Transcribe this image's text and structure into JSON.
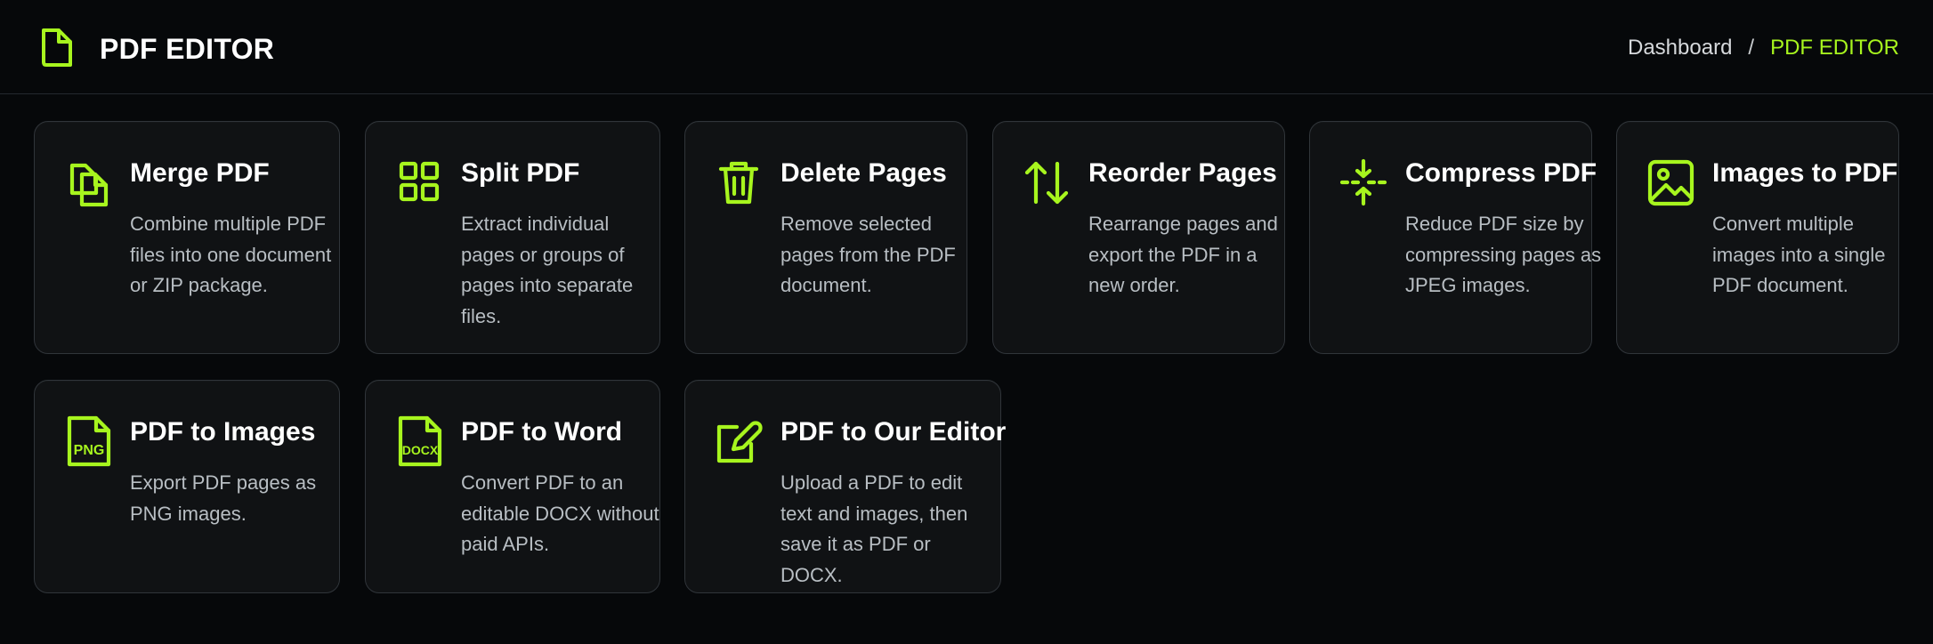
{
  "header": {
    "title": "PDF EDITOR",
    "brand_icon": "document-icon",
    "breadcrumb": {
      "home": "Dashboard",
      "separator": "/",
      "current": "PDF EDITOR"
    }
  },
  "tools": [
    {
      "title": "Merge PDF",
      "description": "Combine multiple PDF files into one document or ZIP package.",
      "icon": "merge-icon"
    },
    {
      "title": "Split PDF",
      "description": "Extract individual pages or groups of pages into separate files.",
      "icon": "grid-icon"
    },
    {
      "title": "Delete Pages",
      "description": "Remove selected pages from the PDF document.",
      "icon": "trash-icon"
    },
    {
      "title": "Reorder Pages",
      "description": "Rearrange pages and export the PDF in a new order.",
      "icon": "reorder-arrows-icon"
    },
    {
      "title": "Compress PDF",
      "description": "Reduce PDF size by compressing pages as JPEG images.",
      "icon": "compress-icon"
    },
    {
      "title": "Images to PDF",
      "description": "Convert multiple images into a single PDF document.",
      "icon": "image-icon"
    },
    {
      "title": "PDF to Images",
      "description": "Export PDF pages as PNG images.",
      "icon": "png-file-icon",
      "icon_label": "PNG"
    },
    {
      "title": "PDF to Word",
      "description": "Convert PDF to an editable DOCX without paid APIs.",
      "icon": "docx-file-icon",
      "icon_label": "DOCX"
    },
    {
      "title": "PDF to Our Editor",
      "description": "Upload a PDF to edit text and images, then save it as PDF or DOCX.",
      "icon": "edit-icon"
    }
  ],
  "colors": {
    "background": "#06080a",
    "card": "#101214",
    "border": "#30353a",
    "accent": "#a7f51e",
    "text": "#ffffff",
    "muted_text": "#b8bec3"
  }
}
